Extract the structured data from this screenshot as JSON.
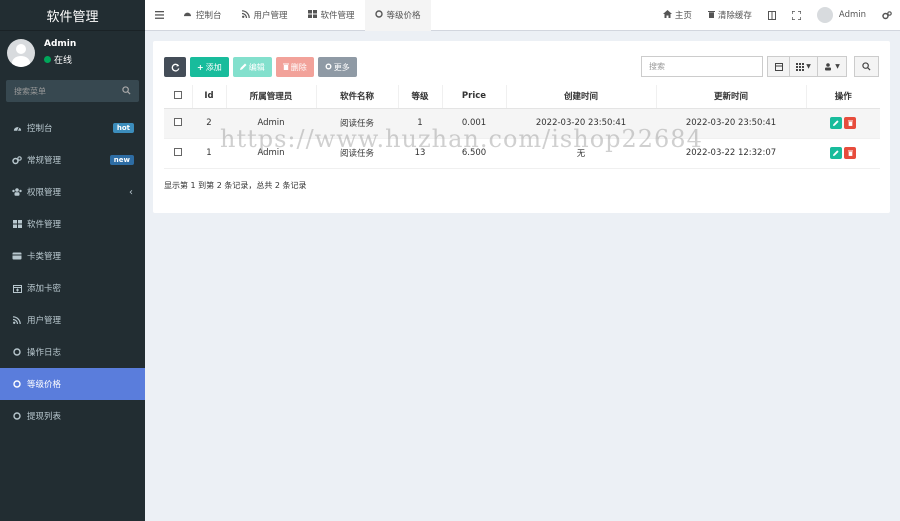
{
  "sidebar": {
    "brand": "软件管理",
    "user": {
      "name": "Admin",
      "status": "在线"
    },
    "search_placeholder": "搜索菜单",
    "items": [
      {
        "label": "控制台",
        "icon": "dashboard-icon",
        "badge": "hot"
      },
      {
        "label": "常规管理",
        "icon": "cogs-icon",
        "badge": "new"
      },
      {
        "label": "权限管理",
        "icon": "group-icon",
        "arrow": "‹"
      },
      {
        "label": "软件管理",
        "icon": "grid-icon"
      },
      {
        "label": "卡类管理",
        "icon": "card-icon"
      },
      {
        "label": "添加卡密",
        "icon": "calendar-plus-icon"
      },
      {
        "label": "用户管理",
        "icon": "rss-icon"
      },
      {
        "label": "操作日志",
        "icon": "circle-icon"
      },
      {
        "label": "等级价格",
        "icon": "circle-icon",
        "active": true
      },
      {
        "label": "提现列表",
        "icon": "circle-icon"
      }
    ]
  },
  "topbar": {
    "tabs": [
      {
        "label": "控制台",
        "icon": "dashboard-icon"
      },
      {
        "label": "用户管理",
        "icon": "rss-icon"
      },
      {
        "label": "软件管理",
        "icon": "grid-icon"
      },
      {
        "label": "等级价格",
        "icon": "circle-icon",
        "active": true
      }
    ],
    "home_label": "主页",
    "clear_cache_label": "清除缓存",
    "user_name": "Admin"
  },
  "toolbar": {
    "add_label": "添加",
    "edit_label": "编辑",
    "delete_label": "删除",
    "more_label": "更多",
    "search_placeholder": "搜索"
  },
  "table": {
    "columns": [
      "Id",
      "所属管理员",
      "软件名称",
      "等级",
      "Price",
      "创建时间",
      "更新时间",
      "操作"
    ],
    "rows": [
      {
        "id": "2",
        "admin": "Admin",
        "software": "阅读任务",
        "level": "1",
        "price": "0.001",
        "created": "2022-03-20 23:50:41",
        "updated": "2022-03-20 23:50:41"
      },
      {
        "id": "1",
        "admin": "Admin",
        "software": "阅读任务",
        "level": "13",
        "price": "6.500",
        "created": "无",
        "updated": "2022-03-22 12:32:07"
      }
    ],
    "footer": "显示第 1 到第 2 条记录，总共 2 条记录"
  },
  "watermark": "https://www.huzhan.com/ishop22684"
}
